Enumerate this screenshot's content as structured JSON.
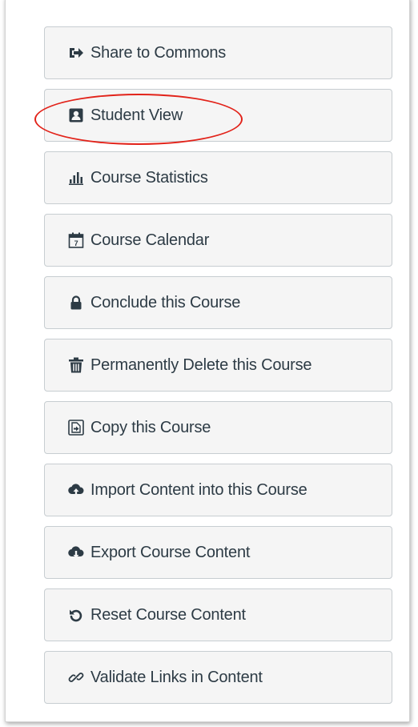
{
  "colors": {
    "button_bg": "#f5f5f5",
    "button_border": "#c7cdd1",
    "text": "#2d3b45",
    "icon": "#2d3b45",
    "highlight": "#e2231a"
  },
  "menu": {
    "items": [
      {
        "label": "Share to Commons",
        "icon": "share-icon"
      },
      {
        "label": "Student View",
        "icon": "student-view-icon"
      },
      {
        "label": "Course Statistics",
        "icon": "bar-chart-icon"
      },
      {
        "label": "Course Calendar",
        "icon": "calendar-icon"
      },
      {
        "label": "Conclude this Course",
        "icon": "lock-icon"
      },
      {
        "label": "Permanently Delete this Course",
        "icon": "trash-icon"
      },
      {
        "label": "Copy this Course",
        "icon": "copy-icon"
      },
      {
        "label": "Import Content into this Course",
        "icon": "cloud-upload-icon"
      },
      {
        "label": "Export Course Content",
        "icon": "cloud-download-icon"
      },
      {
        "label": "Reset Course Content",
        "icon": "reset-icon"
      },
      {
        "label": "Validate Links in Content",
        "icon": "link-icon"
      }
    ]
  },
  "calendar_icon_day": "7",
  "highlight_target": "Student View"
}
